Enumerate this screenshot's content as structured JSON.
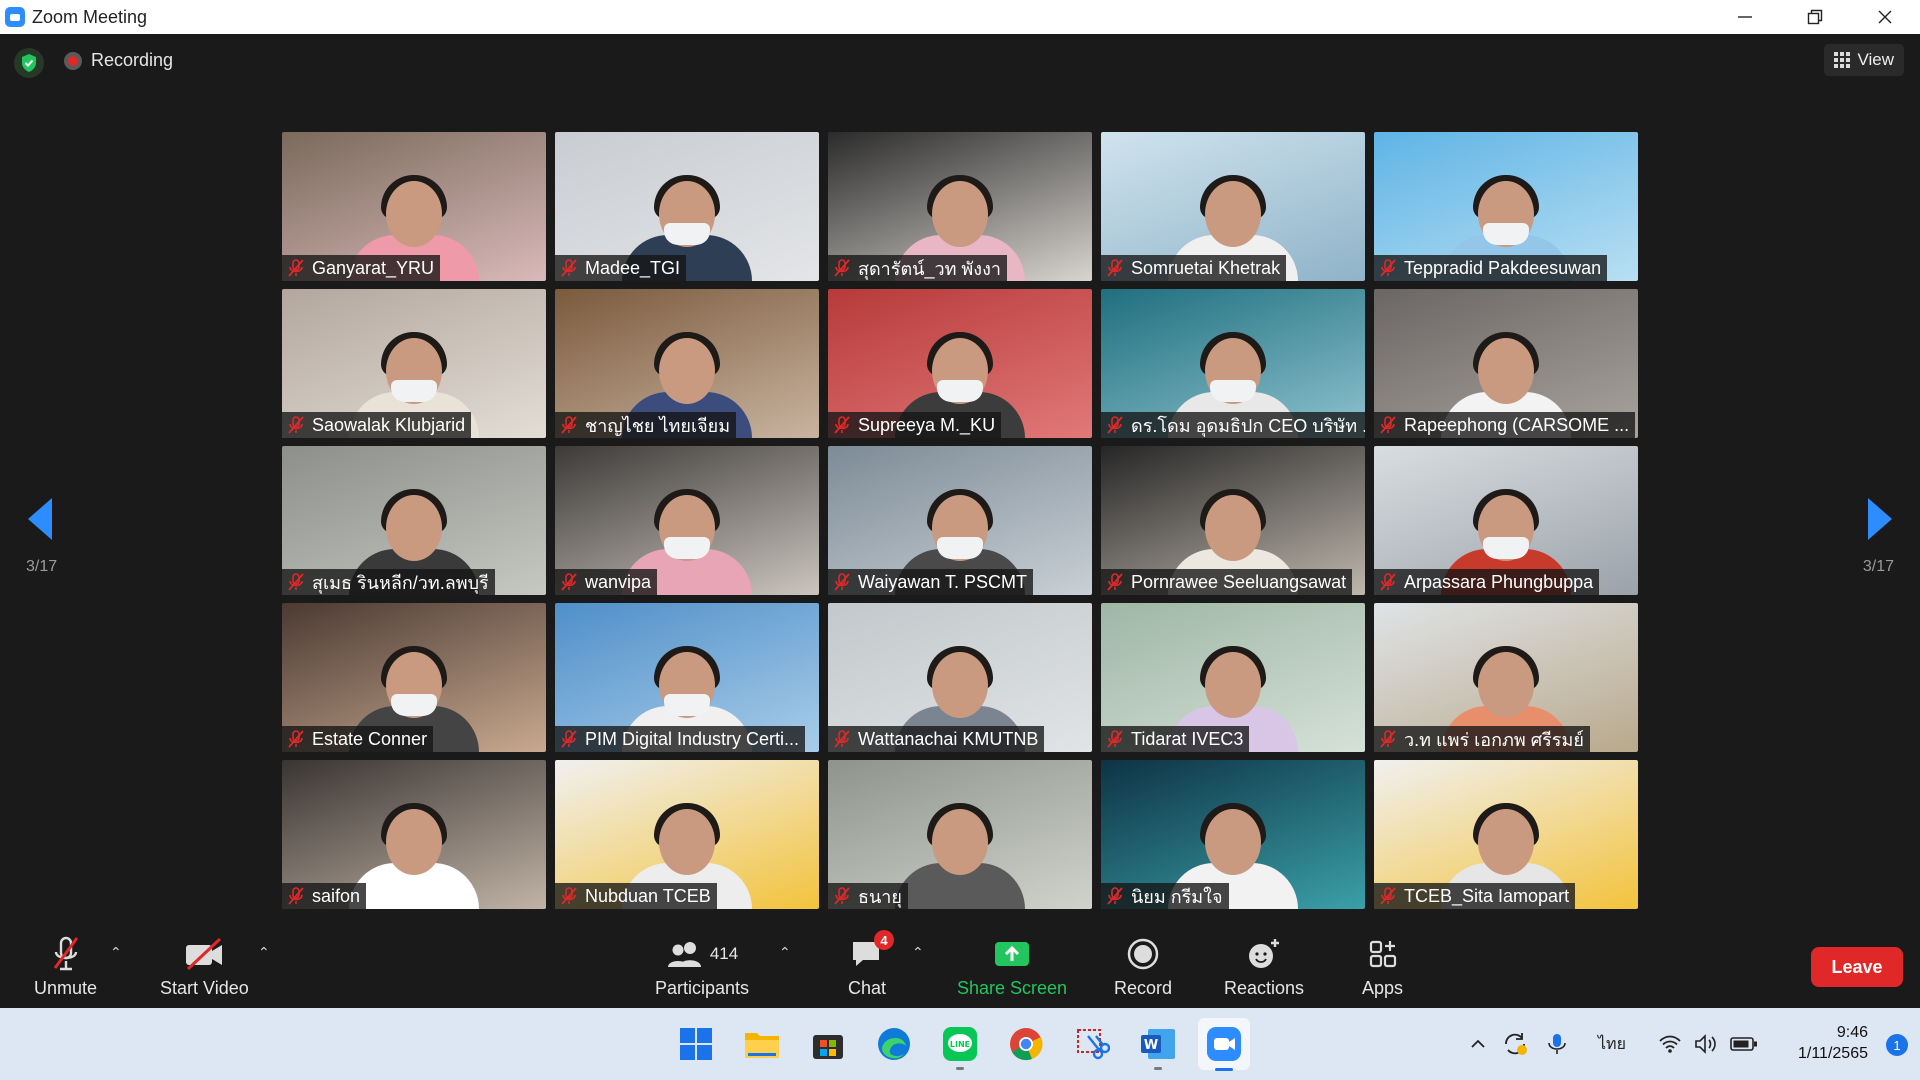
{
  "window": {
    "title": "Zoom Meeting",
    "controls": [
      "minimize",
      "restore",
      "close"
    ]
  },
  "header": {
    "recording_label": "Recording",
    "view_label": "View"
  },
  "pagination": {
    "left": "3/17",
    "right": "3/17"
  },
  "participants": [
    {
      "name": "Ganyarat_YRU"
    },
    {
      "name": "Madee_TGI"
    },
    {
      "name": "สุดารัตน์_วท พังงา"
    },
    {
      "name": "Somruetai Khetrak"
    },
    {
      "name": "Teppradid Pakdeesuwan"
    },
    {
      "name": "Saowalak Klubjarid"
    },
    {
      "name": "ชาญไชย ไทยเจียม"
    },
    {
      "name": "Supreeya M._KU"
    },
    {
      "name": "ดร.โดม อุดมธิปก CEO บริษัท ..."
    },
    {
      "name": "Rapeephong (CARSOME ..."
    },
    {
      "name": "สุเมธ รินหลีก/วท.ลพบุรี"
    },
    {
      "name": "wanvipa"
    },
    {
      "name": "Waiyawan T. PSCMT"
    },
    {
      "name": "Pornrawee Seeluangsawat"
    },
    {
      "name": "Arpassara Phungbuppa"
    },
    {
      "name": "Estate Conner"
    },
    {
      "name": "PIM Digital Industry Certi..."
    },
    {
      "name": "Wattanachai KMUTNB"
    },
    {
      "name": "Tidarat IVEC3"
    },
    {
      "name": "ว.ท แพร่ เอกภพ ศรีรมย์"
    },
    {
      "name": "saifon"
    },
    {
      "name": "Nubduan TCEB"
    },
    {
      "name": "ธนายุ"
    },
    {
      "name": "นิยม กรีมใจ"
    },
    {
      "name": "TCEB_Sita Iamopart"
    }
  ],
  "toolbar": {
    "unmute": "Unmute",
    "start_video": "Start Video",
    "participants_label": "Participants",
    "participants_count": "414",
    "chat": "Chat",
    "chat_badge": "4",
    "share_screen": "Share Screen",
    "record": "Record",
    "reactions": "Reactions",
    "apps": "Apps",
    "leave": "Leave"
  },
  "taskbar": {
    "apps": [
      "windows-start",
      "file-explorer",
      "microsoft-store",
      "edge",
      "line",
      "chrome",
      "snipping-tool",
      "word",
      "zoom"
    ],
    "language": "ไทย",
    "time": "9:46",
    "date": "1/11/2565",
    "notification_count": "1"
  },
  "colors": {
    "accent": "#2d8cff",
    "leave": "#e02828",
    "share": "#22c55e",
    "taskbar": "#dde6f3"
  }
}
